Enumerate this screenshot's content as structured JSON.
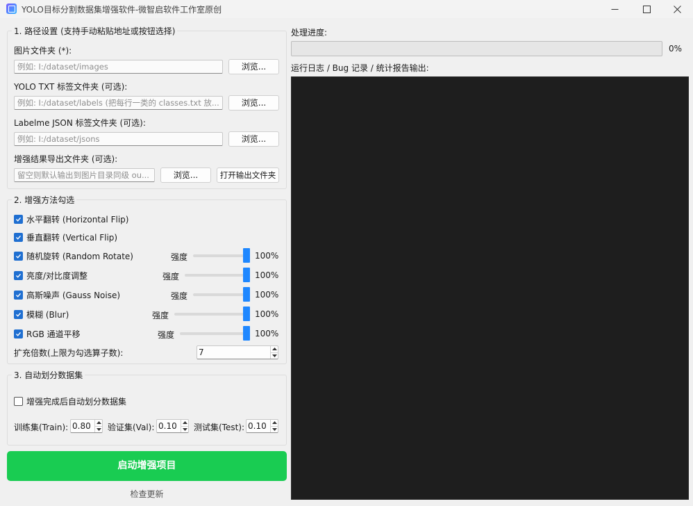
{
  "window": {
    "title": "YOLO目标分割数据集增强软件-微智启软件工作室原创"
  },
  "path_settings": {
    "title": "1. 路径设置 (支持手动粘贴地址或按钮选择)",
    "images_label": "图片文件夹 (*):",
    "images_placeholder": "例如: I:/dataset/images",
    "yolo_label": "YOLO TXT 标签文件夹 (可选):",
    "yolo_placeholder": "例如: I:/dataset/labels (把每行一类的 classes.txt 放...",
    "json_label": "Labelme JSON 标签文件夹 (可选):",
    "json_placeholder": "例如: I:/dataset/jsons",
    "output_label": "增强结果导出文件夹 (可选):",
    "output_placeholder": "留空则默认输出到图片目录同级 ou...",
    "browse_label": "浏览...",
    "open_output_label": "打开输出文件夹"
  },
  "methods": {
    "title": "2. 增强方法勾选",
    "strength_label": "强度",
    "items": [
      {
        "label": "水平翻转 (Horizontal Flip)",
        "checked": true
      },
      {
        "label": "垂直翻转 (Vertical Flip)",
        "checked": true
      },
      {
        "label": "随机旋转 (Random Rotate)",
        "checked": true,
        "strength": "100%",
        "level": 1.0
      },
      {
        "label": "亮度/对比度调整",
        "checked": true,
        "strength": "100%",
        "level": 1.0
      },
      {
        "label": "高斯噪声 (Gauss Noise)",
        "checked": true,
        "strength": "100%",
        "level": 1.0
      },
      {
        "label": "模糊 (Blur)",
        "checked": true,
        "strength": "100%",
        "level": 1.0
      },
      {
        "label": "RGB 通道平移",
        "checked": true,
        "strength": "100%",
        "level": 1.0
      }
    ],
    "multiplier_label": "扩充倍数(上限为勾选算子数):",
    "multiplier_value": "7"
  },
  "split": {
    "title": "3. 自动划分数据集",
    "auto_label": "增强完成后自动划分数据集",
    "auto_checked": false,
    "train_label": "训练集(Train):",
    "train_value": "0.80",
    "val_label": "验证集(Val):",
    "val_value": "0.10",
    "test_label": "测试集(Test):",
    "test_value": "0.10"
  },
  "actions": {
    "start_label": "启动增强项目",
    "update_label": "检查更新"
  },
  "progress": {
    "label": "处理进度:",
    "percent_text": "0%",
    "value": 0
  },
  "log": {
    "label": "运行日志 / Bug 记录 / 统计报告输出:",
    "content": ""
  },
  "colors": {
    "accent": "#1e87ff",
    "start_button": "#19cc52",
    "log_background": "#1e1e1e"
  }
}
